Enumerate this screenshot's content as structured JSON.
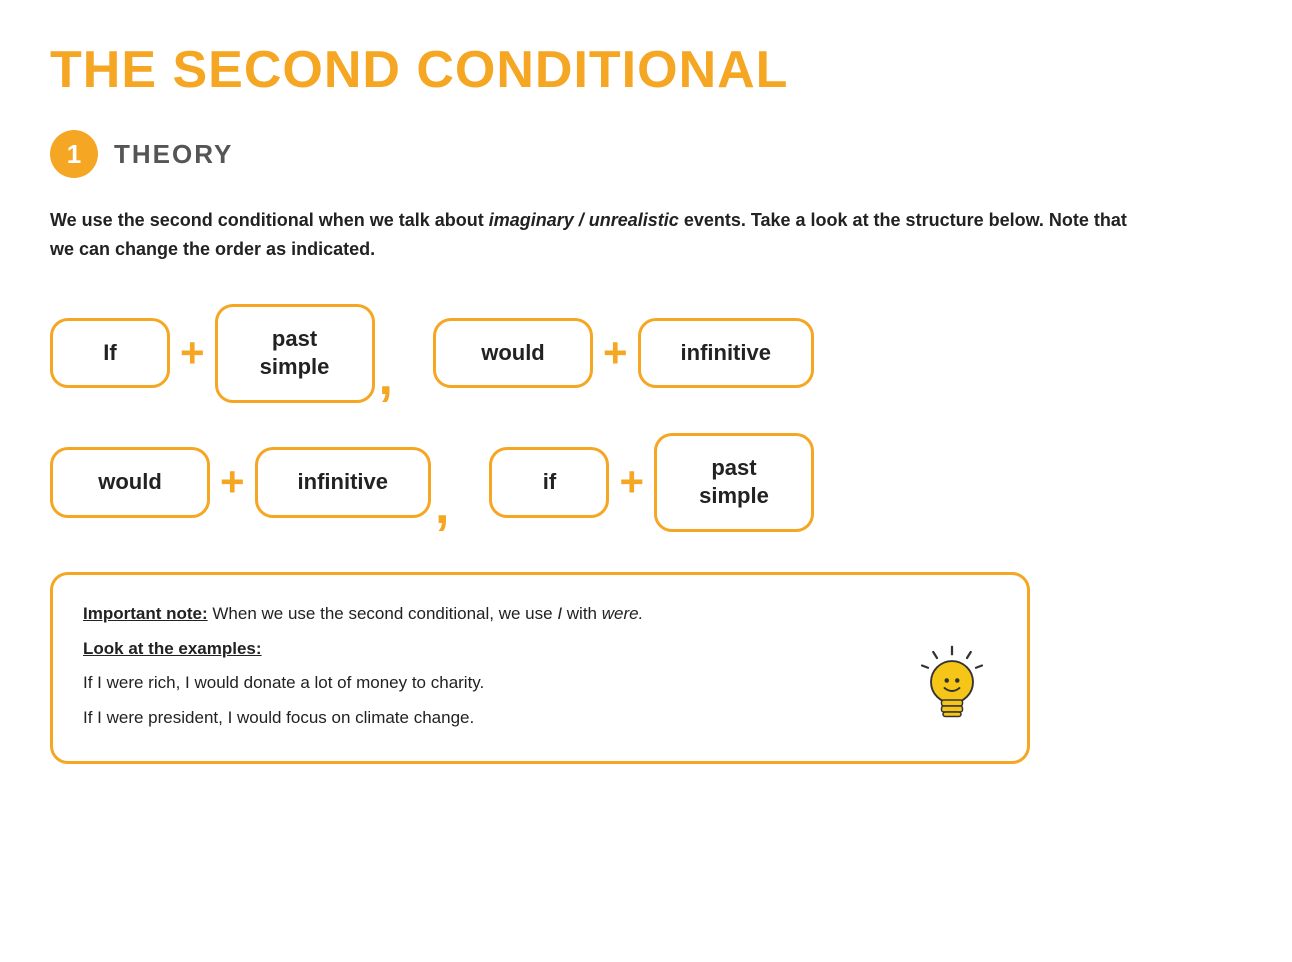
{
  "title": "THE SECOND CONDITIONAL",
  "section": {
    "number": "1",
    "label": "THEORY"
  },
  "intro": {
    "text_before_italic": "We use the second conditional when we talk about ",
    "italic_text": "imaginary / unrealistic",
    "text_after_italic": " events. Take a look at the structure below. Note that we can change the order as indicated."
  },
  "formula_row1": {
    "box1": "If",
    "plus1": "+",
    "box2_line1": "past",
    "box2_line2": "simple",
    "comma": ",",
    "box3": "would",
    "plus2": "+",
    "box4": "infinitive"
  },
  "formula_row2": {
    "box1": "would",
    "plus1": "+",
    "box2": "infinitive",
    "comma": ",",
    "box3": "if",
    "plus2": "+",
    "box4_line1": "past",
    "box4_line2": "simple"
  },
  "note": {
    "important_label": "Important note:",
    "important_text": " When we use the second conditional, we use ",
    "i_italic": "I",
    "with_were": " with ",
    "were_italic": "were.",
    "look_label": "Look at the examples:",
    "example1": "If I were rich, I would donate a lot of money to charity.",
    "example2": "If I were president, I would focus on climate change."
  }
}
